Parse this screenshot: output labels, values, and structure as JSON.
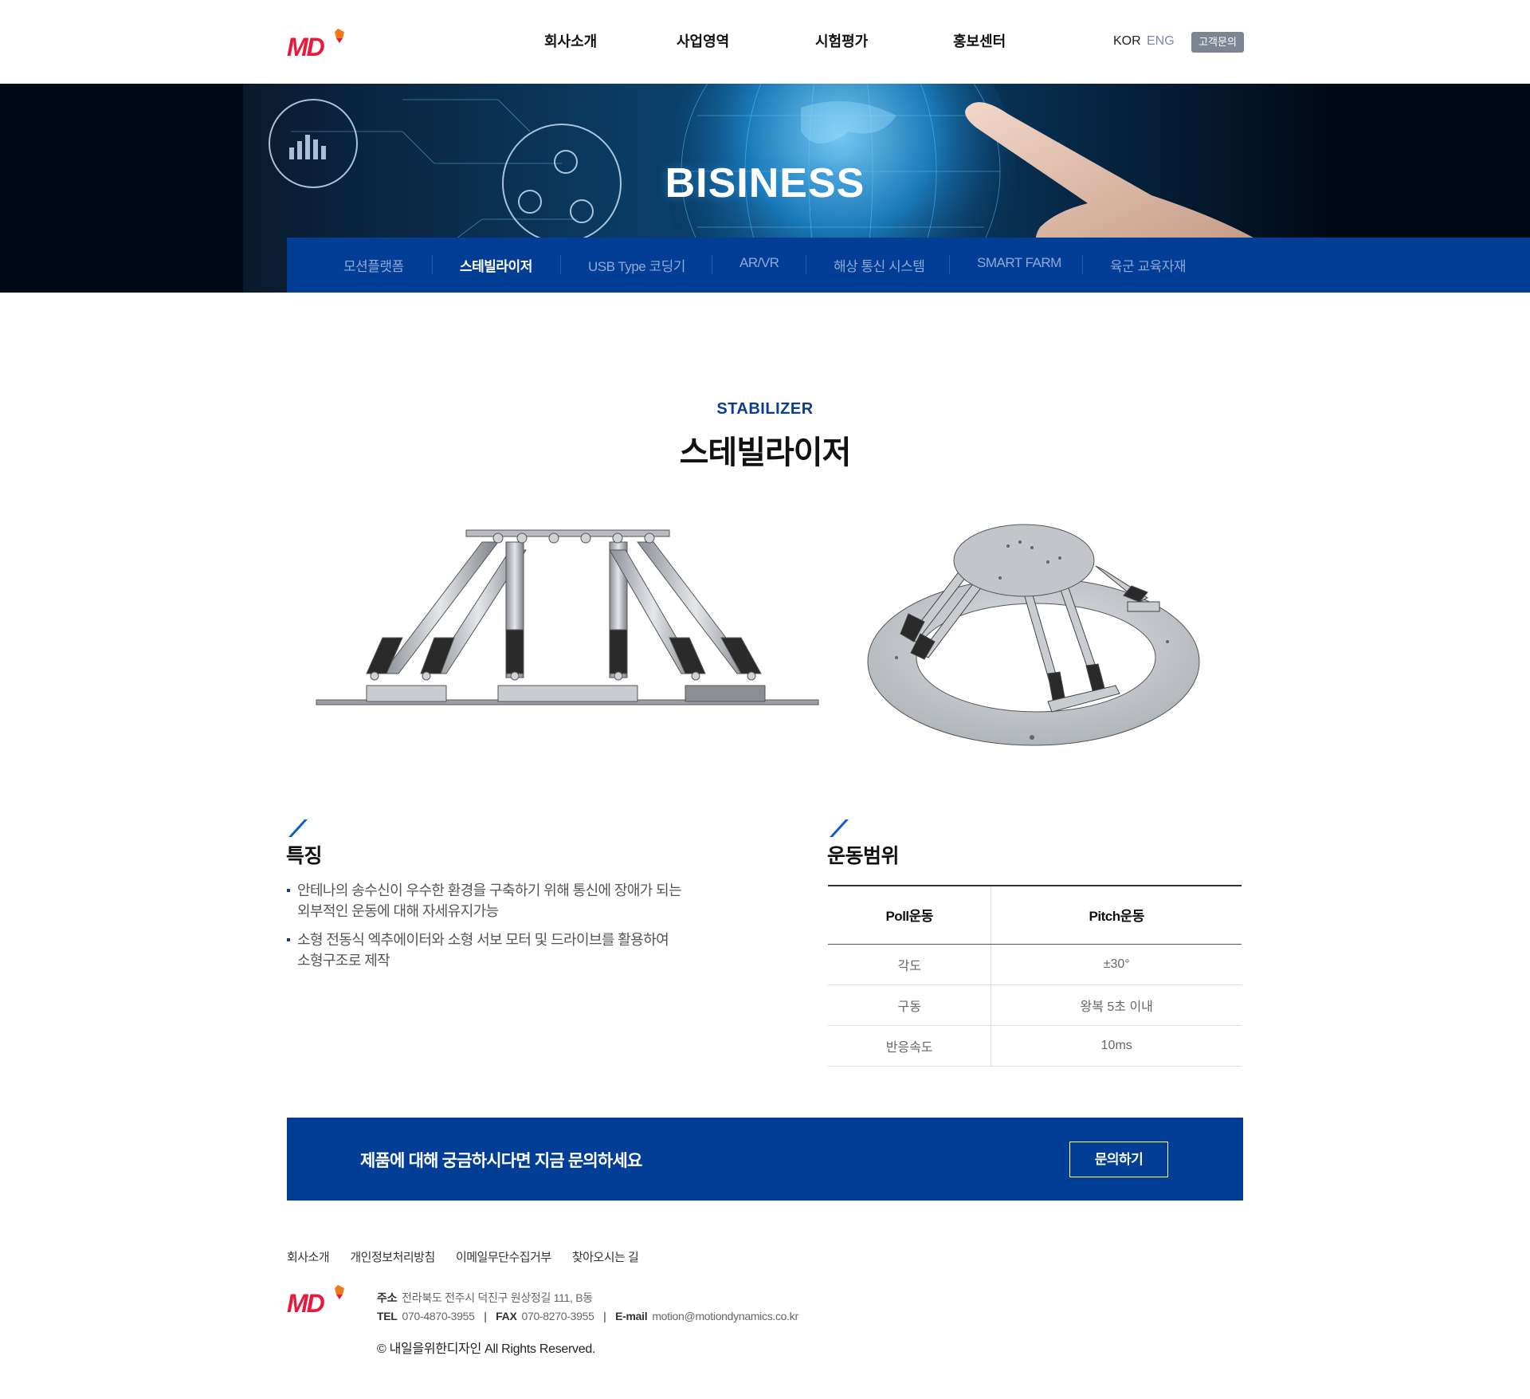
{
  "header": {
    "logo_text": "MD",
    "nav": [
      "회사소개",
      "사업영역",
      "시험평가",
      "홍보센터"
    ],
    "lang_kor": "KOR",
    "lang_eng": "ENG",
    "contact": "고객문의"
  },
  "hero": {
    "title": "BISINESS"
  },
  "subnav": {
    "items": [
      "모션플랫폼",
      "스테빌라이저",
      "USB Type 코딩기",
      "AR/VR",
      "해상 통신 시스템",
      "SMART FARM",
      "육군 교육자재"
    ],
    "active_index": 1
  },
  "section": {
    "title_en": "STABILIZER",
    "title_ko": "스테빌라이저"
  },
  "features": {
    "title": "특징",
    "items": [
      "안테나의 송수신이 우수한 환경을 구축하기 위해 통신에 장애가 되는\n외부적인 운동에 대해 자세유지가능",
      "소형 전동식 엑추에이터와 소형 서보 모터 및 드라이브를 활용하여\n 소형구조로 제작"
    ]
  },
  "motion": {
    "title": "운동범위",
    "headers": [
      "Poll운동",
      "Pitch운동"
    ],
    "rows": [
      [
        "각도",
        "±30°"
      ],
      [
        "구동",
        "왕복 5초 이내"
      ],
      [
        "반응속도",
        "10ms"
      ]
    ]
  },
  "cta": {
    "text": "제품에 대해 궁금하시다면 지금 문의하세요",
    "button": "문의하기"
  },
  "footer": {
    "links": [
      "회사소개",
      "개인정보처리방침",
      "이메일무단수집거부",
      "찾아오시는 길"
    ],
    "address_label": "주소",
    "address": "전라북도 전주시 덕진구 원상정길 111, B동",
    "contact_line": [
      {
        "label": "TEL",
        "value": "070-4870-3955"
      },
      {
        "label": "FAX",
        "value": "070-8270-3955"
      },
      {
        "label": "E-mail",
        "value": "motion@motiondynamics.co.kr"
      }
    ],
    "copyright": "© 내일을위한디자인  All Rights Reserved."
  },
  "colors": {
    "brand_blue": "#033e96",
    "brand_red": "#e8193c",
    "accent_orange": "#f07a1a"
  }
}
